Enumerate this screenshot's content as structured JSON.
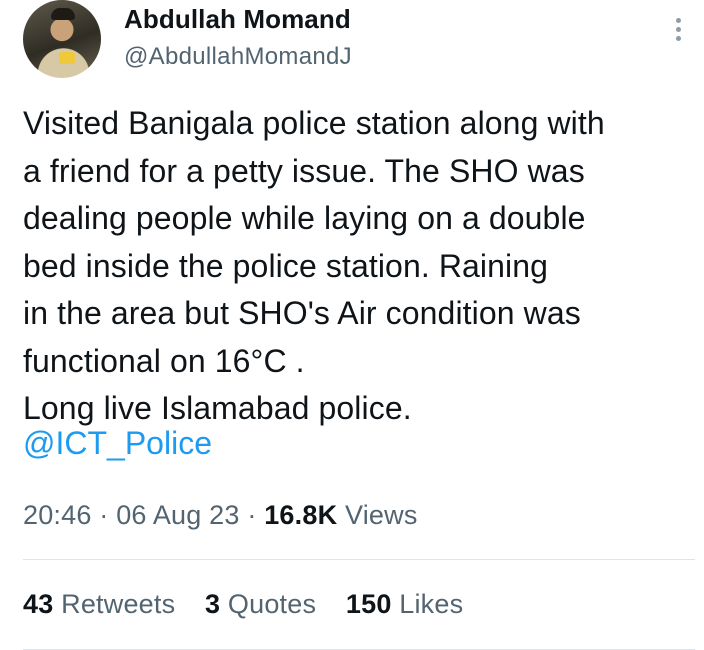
{
  "author": {
    "name": "Abdullah Momand",
    "handle": "@AbdullahMomandJ"
  },
  "tweet": {
    "text": "Visited Banigala police station along with\na friend for a petty issue. The SHO was\ndealing  people while laying on a double\nbed inside the police station. Raining\nin the area but SHO's Air condition was\nfunctional on 16°C .\nLong live Islamabad police.",
    "mention": "@ICT_Police"
  },
  "meta": {
    "time": "20:46",
    "date": "06 Aug 23",
    "separator": "·",
    "views_count": "16.8K",
    "views_label": "Views"
  },
  "stats": {
    "retweets_count": "43",
    "retweets_label": "Retweets",
    "quotes_count": "3",
    "quotes_label": "Quotes",
    "likes_count": "150",
    "likes_label": "Likes"
  },
  "colors": {
    "link": "#1d9bf0",
    "secondary_text": "#536471",
    "primary_text": "#0f1419"
  },
  "icons": {
    "more": "more-vertical-icon"
  }
}
